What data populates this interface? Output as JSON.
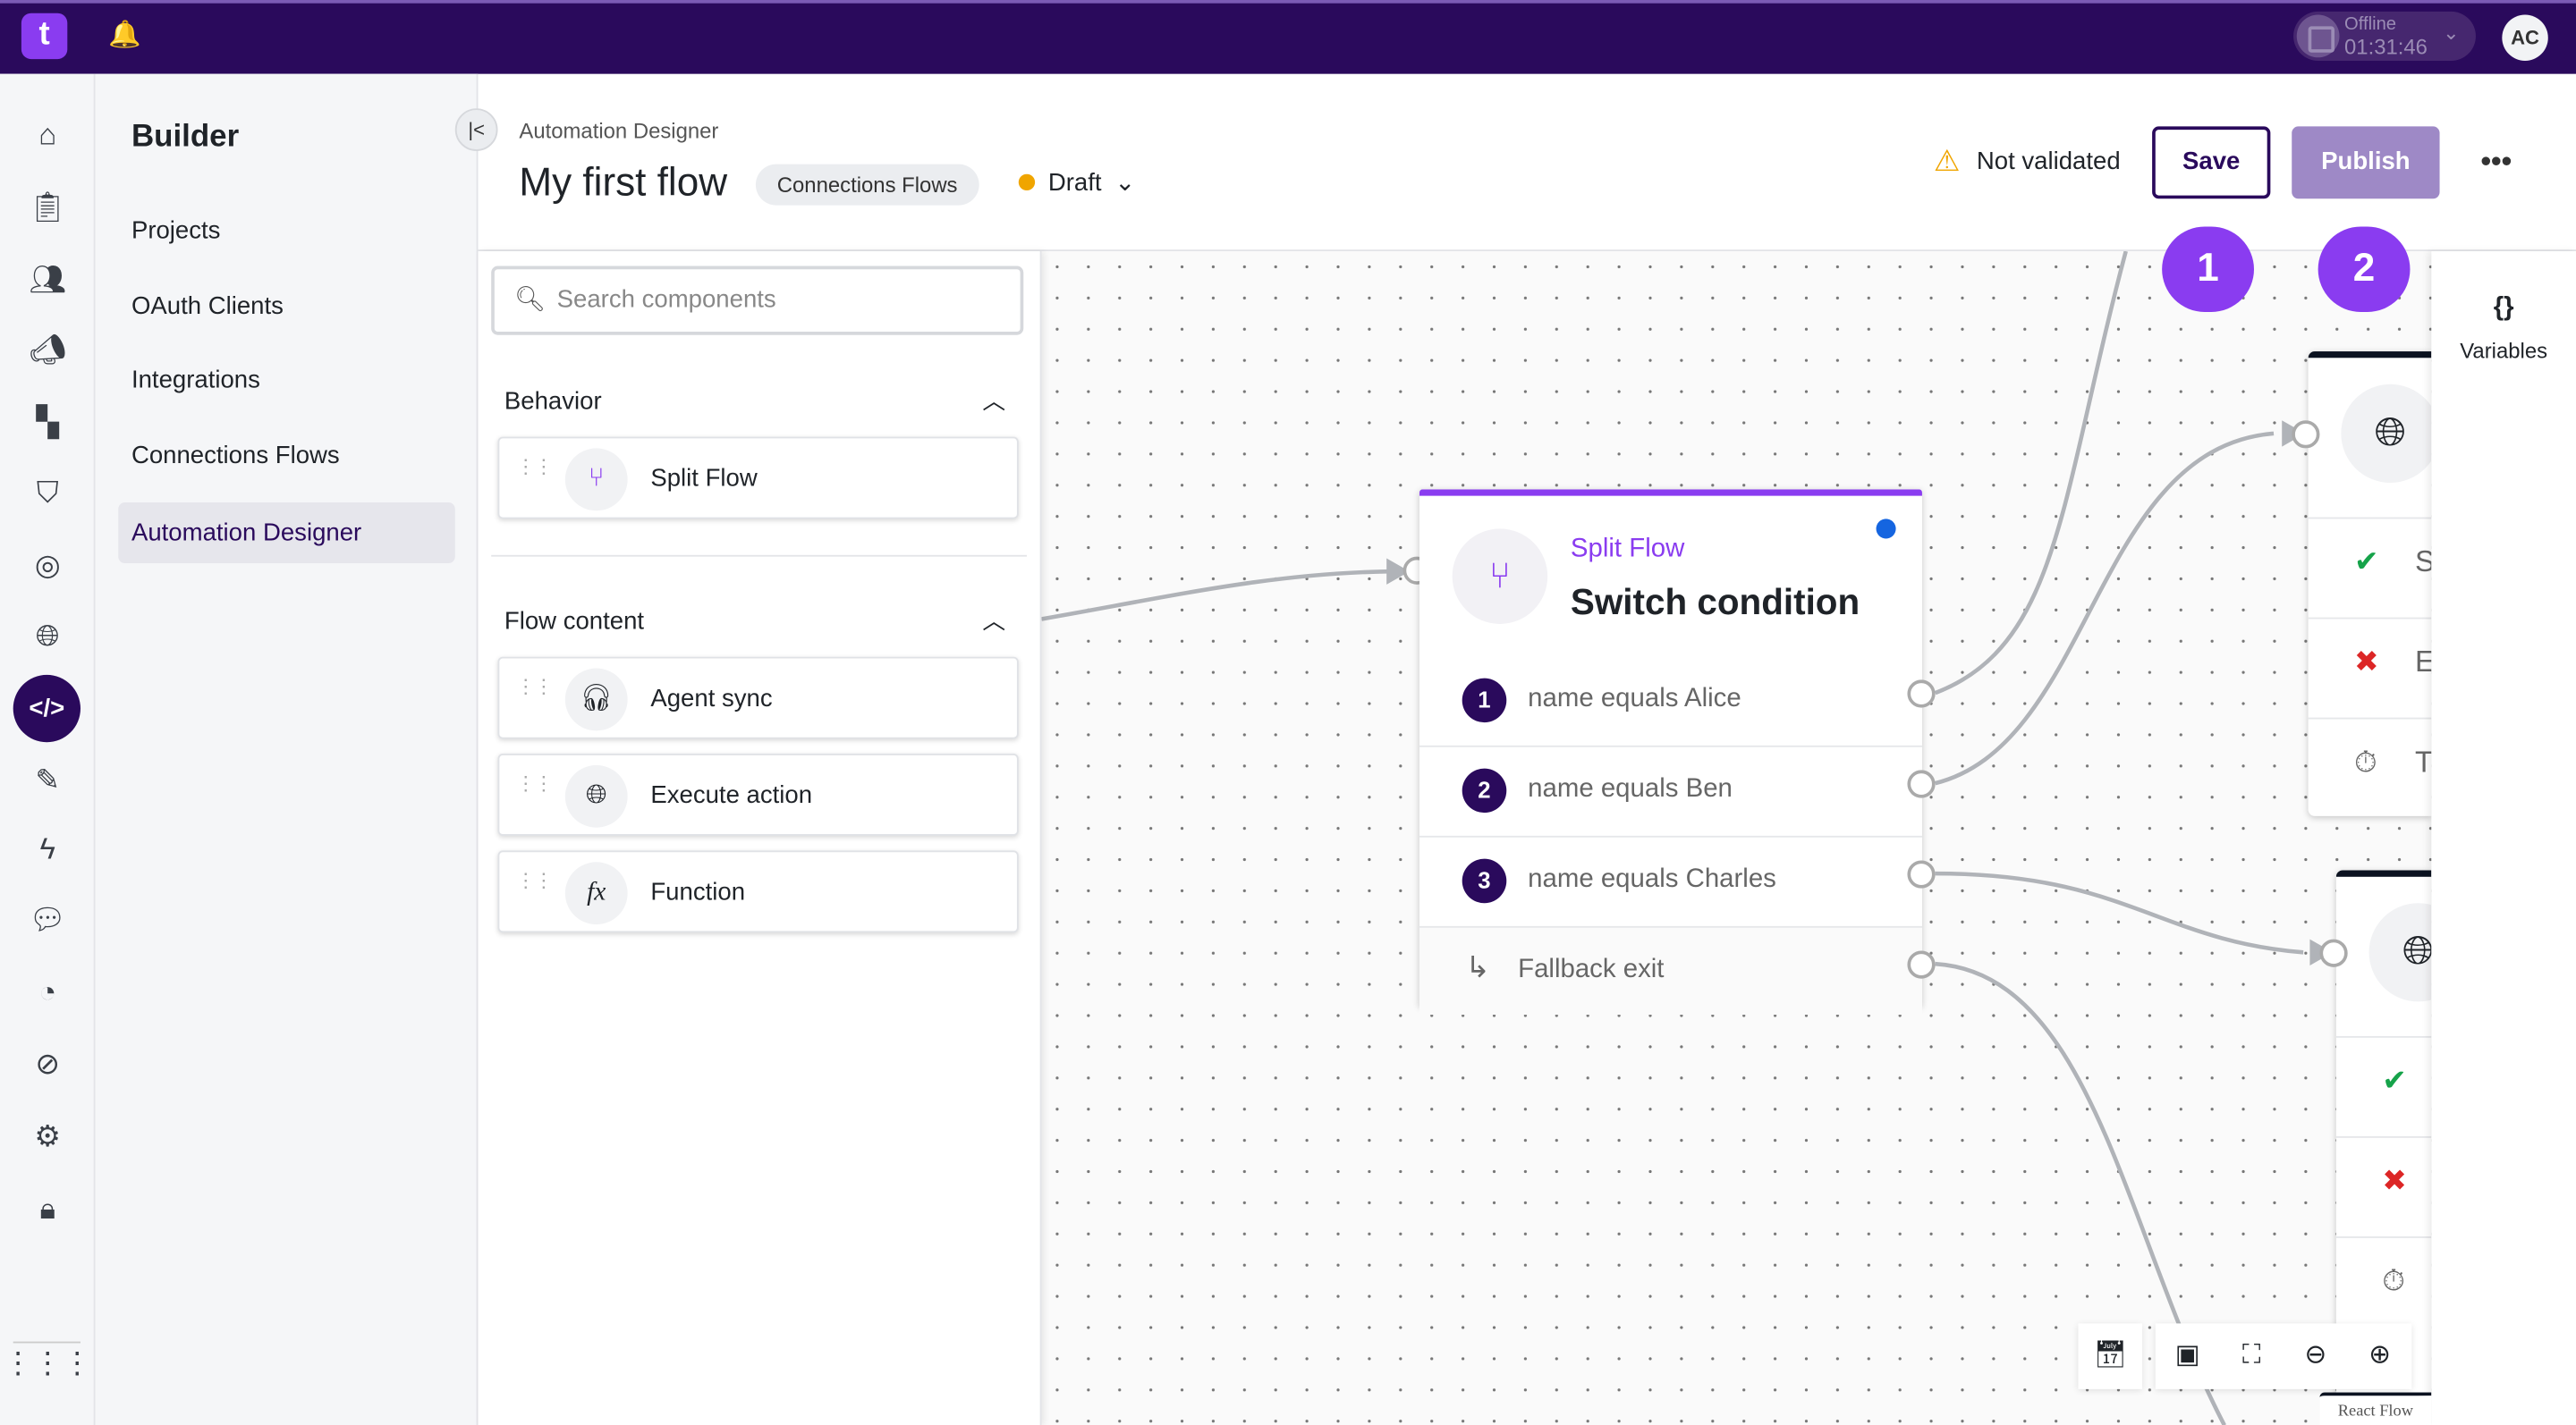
{
  "topbar": {
    "logo": "t",
    "status_label": "Offline",
    "timer": "01:31:46",
    "avatar": "AC",
    "icons": [
      "bell-icon",
      "stop-icon",
      "chevron-down-icon"
    ]
  },
  "rail": {
    "icons": [
      "home-icon",
      "clipboard-icon",
      "users-icon",
      "megaphone-icon",
      "dashboard-icon",
      "shield-icon",
      "fingerprint-icon",
      "globe-icon",
      "code-icon",
      "edit-icon",
      "bolt-icon",
      "chat-icon",
      "gauge-icon",
      "compass-icon",
      "gear-icon",
      "lock-icon",
      "apps-grid-icon"
    ],
    "active": "code-icon"
  },
  "sidebar": {
    "title": "Builder",
    "items": [
      {
        "label": "Projects"
      },
      {
        "label": "OAuth Clients"
      },
      {
        "label": "Integrations"
      },
      {
        "label": "Connections Flows"
      },
      {
        "label": "Automation Designer",
        "active": true
      }
    ]
  },
  "header": {
    "breadcrumb": "Automation Designer",
    "title": "My first flow",
    "chip": "Connections Flows",
    "status": "Draft",
    "validation": "Not validated",
    "save": "Save",
    "publish": "Publish",
    "colors": {
      "primary": "#2a0a5c",
      "accent": "#8a3cf0",
      "draft": "#f0a500"
    }
  },
  "palette": {
    "search_placeholder": "Search components",
    "sections": [
      {
        "title": "Behavior",
        "items": [
          {
            "label": "Split Flow",
            "icon": "split-icon"
          }
        ]
      },
      {
        "title": "Flow content",
        "items": [
          {
            "label": "Agent sync",
            "icon": "headset-icon"
          },
          {
            "label": "Execute action",
            "icon": "globe-icon"
          },
          {
            "label": "Function",
            "icon": "function-icon"
          }
        ]
      }
    ]
  },
  "node": {
    "type": "Split Flow",
    "title": "Switch condition",
    "conditions": [
      {
        "n": "1",
        "label": "name equals Alice"
      },
      {
        "n": "2",
        "label": "name equals Ben"
      },
      {
        "n": "3",
        "label": "name equals Charles"
      }
    ],
    "fallback": "Fallback exit"
  },
  "right_nodes": {
    "rows": [
      "S",
      "E",
      "T"
    ]
  },
  "badges": [
    "1",
    "2"
  ],
  "variables": {
    "icon": "{}",
    "label": "Variables"
  },
  "controls": [
    "calendar-icon",
    "minimap-icon",
    "fit-view-icon",
    "zoom-out-icon",
    "zoom-in-icon"
  ],
  "attribution": "React Flow"
}
